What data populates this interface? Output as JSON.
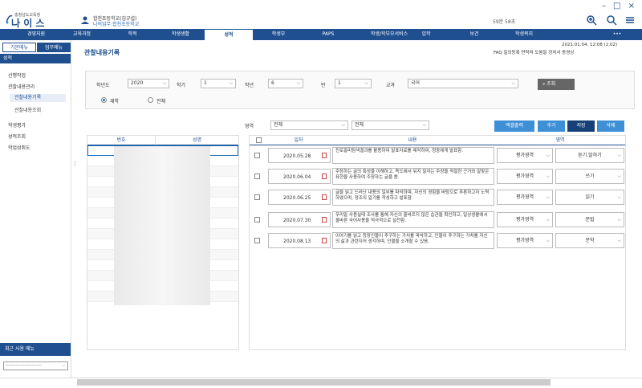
{
  "window": {
    "controls": "– □ ×"
  },
  "logo": {
    "sub": "충청남도교육청",
    "main": "나 이 스"
  },
  "user": {
    "name": "합천초등학교(김규섭)",
    "school": "나의업무:합천초등학교"
  },
  "session": {
    "timer": "59분 58초"
  },
  "nav": {
    "items": [
      {
        "label": "경영지원",
        "active": false
      },
      {
        "label": "교육과정",
        "active": false
      },
      {
        "label": "학적",
        "active": false
      },
      {
        "label": "학생생활",
        "active": false
      },
      {
        "label": "성적",
        "active": true
      },
      {
        "label": "학생부",
        "active": false
      },
      {
        "label": "PAPS",
        "active": false
      },
      {
        "label": "학생/학부모서비스",
        "active": false
      },
      {
        "label": "입학",
        "active": false
      },
      {
        "label": "보건",
        "active": false
      },
      {
        "label": "학생복지",
        "active": false
      },
      {
        "label": "•••",
        "active": false
      }
    ]
  },
  "sidebar": {
    "tab_basic": "기본메뉴",
    "tab_work": "업무메뉴",
    "section": "성적",
    "items": [
      {
        "label": "선행작업",
        "level": 1
      },
      {
        "label": "관찰내용관리",
        "level": 1
      },
      {
        "label": "관찰내용기록",
        "level": 2,
        "selected": true
      },
      {
        "label": "관찰내용조회",
        "level": 2
      },
      {
        "label": "학생평가",
        "level": 1
      },
      {
        "label": "성적조회",
        "level": 1
      },
      {
        "label": "학업성취도",
        "level": 1
      }
    ],
    "recent": "최근 사용 메뉴",
    "recent_select": "-------------------------"
  },
  "page": {
    "title": "관찰내용기록",
    "datetime": "2021.01.04. 12:08 (2.02)",
    "links": "FAQ  질의등록  연락처  도움말  정처서  동영상"
  },
  "filter": {
    "year_label": "학년도",
    "year": "2020",
    "term_label": "학기",
    "term": "1",
    "grade_label": "학년",
    "grade": "6",
    "class_label": "반",
    "class": "1",
    "subject_label": "교과",
    "subject": "국어",
    "search": "조회",
    "radio_enrolled": "재학",
    "radio_all": "전체"
  },
  "area": {
    "label": "영역",
    "sel1": "전체",
    "sel2": "전체"
  },
  "buttons": {
    "excel": "엑셀출력",
    "add": "추가",
    "save": "저장",
    "delete": "삭제"
  },
  "left_table": {
    "col_no": "번호",
    "col_name": "성명"
  },
  "right_table": {
    "col_date": "일자",
    "col_content": "내용",
    "col_area": "영역",
    "rows": [
      {
        "date": "2020.05.28",
        "content": "진로흥미탐색결과를 활용하여 발표자료를 제작하여, 청중에게 발표함.",
        "area": "평가영역",
        "sub": "듣기.말하기"
      },
      {
        "date": "2020.06.04",
        "content": "주장하는 글의 특성을 이해하고, 독도에서 뒤지 말자는 주장을 적절한 근거와 알맞은 표현을 사용하여 주장하는 글을 씀.",
        "area": "평가영역",
        "sub": "쓰기"
      },
      {
        "date": "2020.06.25",
        "content": "글을 읽고 드러난 내용의 일부를 파악하며, 자신의 경험을 바탕으로 추론하고자 노력하였으며, 정조의 일기를 작성하고 발표함.",
        "area": "평가영역",
        "sub": "읽기"
      },
      {
        "date": "2020.07.30",
        "content": "우리말 사용실태 조사를 통해 자신의 홀바르지 않은 습관을 확인하고, 일상생활에서 올바른 국어사용을 적극적으로 실천함.",
        "area": "평가영역",
        "sub": "문법"
      },
      {
        "date": "2020.08.13",
        "content": "이야기를 읽고 등장인물이 추구하는 가치를 파악하고, 인물이 추구하는 가치를 자신의 삶과 관련지어 생각하며, 인물을 소개할 수 있음.",
        "area": "평가영역",
        "sub": "문학"
      }
    ]
  },
  "colors": {
    "primary": "#1f4f8f",
    "excel_btn": "#3f8fd6",
    "save_btn": "#173f78"
  }
}
